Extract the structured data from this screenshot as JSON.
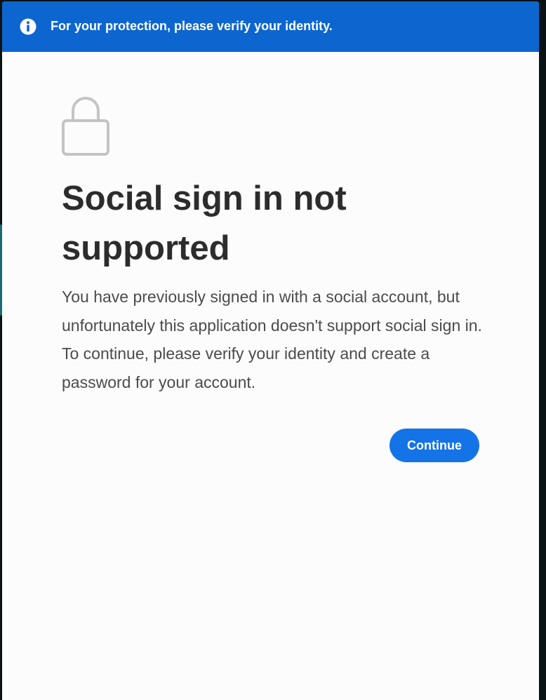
{
  "banner": {
    "icon": "info-icon",
    "text": "For your protection, please verify your identity.",
    "color": "#0d66d0"
  },
  "main": {
    "icon": "lock-icon",
    "title": "Social sign in not supported",
    "body": "You have previously signed in with a social account, but unfortunately this application doesn't support social sign in. To continue, please verify your identity and create a password for your account.",
    "continue_label": "Continue",
    "accent": "#1473e6"
  }
}
